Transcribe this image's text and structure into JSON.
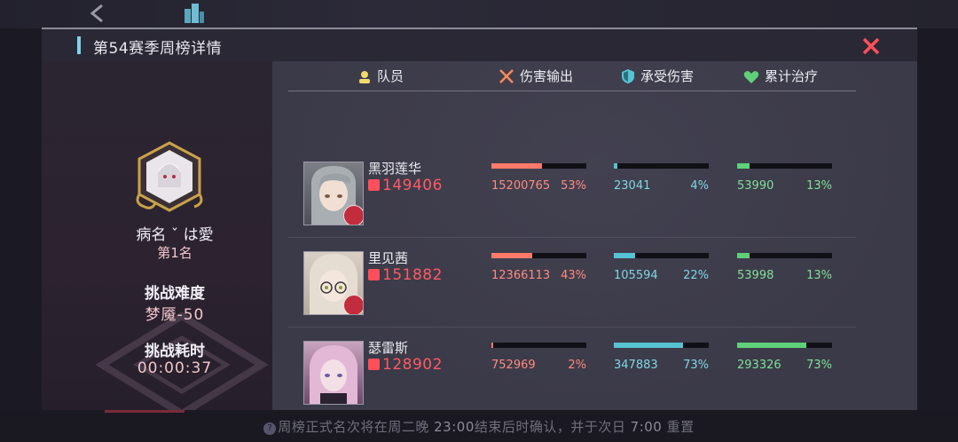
{
  "colors": {
    "damage": "#ff7a6a",
    "taken": "#56c3d3",
    "heal": "#5fd07a",
    "accent_red": "#ff4f5a",
    "title_accent": "#7fd2ea"
  },
  "panel": {
    "title": "第54赛季周榜详情"
  },
  "player": {
    "name": "病名 ˇ は愛",
    "rank": "第1名",
    "difficulty_label": "挑战难度",
    "difficulty_value": "梦魇-50",
    "time_label": "挑战耗时",
    "time_value": "00:00:37"
  },
  "columns": {
    "member": "队员",
    "damage": "伤害输出",
    "taken": "承受伤害",
    "heal": "累计治疗"
  },
  "members": [
    {
      "name": "黑羽莲华",
      "power": "149406",
      "damage": "15200765",
      "damage_pct": "53%",
      "damage_frac": 0.53,
      "taken": "23041",
      "taken_pct": "4%",
      "taken_frac": 0.04,
      "heal": "53990",
      "heal_pct": "13%",
      "heal_frac": 0.13
    },
    {
      "name": "里见茜",
      "power": "151882",
      "damage": "12366113",
      "damage_pct": "43%",
      "damage_frac": 0.43,
      "taken": "105594",
      "taken_pct": "22%",
      "taken_frac": 0.22,
      "heal": "53998",
      "heal_pct": "13%",
      "heal_frac": 0.13
    },
    {
      "name": "瑟雷斯",
      "power": "128902",
      "damage": "752969",
      "damage_pct": "2%",
      "damage_frac": 0.02,
      "taken": "347883",
      "taken_pct": "73%",
      "taken_frac": 0.73,
      "heal": "293326",
      "heal_pct": "73%",
      "heal_frac": 0.73
    }
  ],
  "footer": {
    "notice_a": "周榜正式名次将在周二晚 ",
    "notice_time1": "23:00",
    "notice_b": "结束后时确认，并于次日 ",
    "notice_time2": "7:00",
    "notice_c": " 重置"
  }
}
